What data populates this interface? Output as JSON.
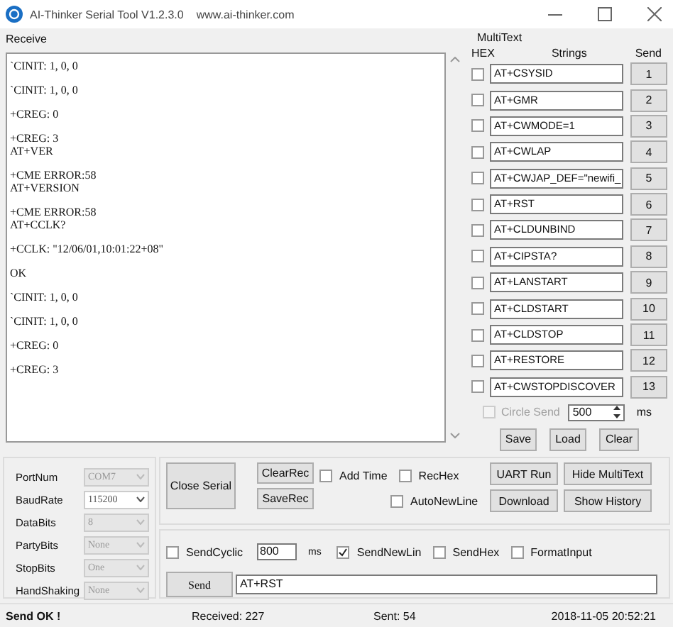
{
  "window": {
    "title": "AI-Thinker Serial Tool V1.2.3.0",
    "url": "www.ai-thinker.com"
  },
  "receive": {
    "label": "Receive",
    "blocks": [
      [
        "`CINIT: 1, 0, 0"
      ],
      [
        "`CINIT: 1, 0, 0"
      ],
      [
        "+CREG: 0"
      ],
      [
        "+CREG: 3",
        "AT+VER"
      ],
      [
        "+CME ERROR:58",
        "AT+VERSION"
      ],
      [
        "+CME ERROR:58",
        "AT+CCLK?"
      ],
      [
        "+CCLK: \"12/06/01,10:01:22+08\""
      ],
      [
        "OK"
      ],
      [
        "`CINIT: 1, 0, 0"
      ],
      [
        "`CINIT: 1, 0, 0"
      ],
      [
        "+CREG: 0"
      ],
      [
        "+CREG: 3"
      ]
    ]
  },
  "multitext": {
    "label": "MultiText",
    "headers": [
      "HEX",
      "Strings",
      "Send"
    ],
    "rows": [
      {
        "hex": false,
        "text": "AT+CSYSID",
        "send": "1"
      },
      {
        "hex": false,
        "text": "AT+GMR",
        "send": "2"
      },
      {
        "hex": false,
        "text": "AT+CWMODE=1",
        "send": "3"
      },
      {
        "hex": false,
        "text": "AT+CWLAP",
        "send": "4"
      },
      {
        "hex": false,
        "text": "AT+CWJAP_DEF=\"newifi_",
        "send": "5"
      },
      {
        "hex": false,
        "text": "AT+RST",
        "send": "6"
      },
      {
        "hex": false,
        "text": "AT+CLDUNBIND",
        "send": "7"
      },
      {
        "hex": false,
        "text": "AT+CIPSTA?",
        "send": "8"
      },
      {
        "hex": false,
        "text": "AT+LANSTART",
        "send": "9"
      },
      {
        "hex": false,
        "text": "AT+CLDSTART",
        "send": "10"
      },
      {
        "hex": false,
        "text": "AT+CLDSTOP",
        "send": "11"
      },
      {
        "hex": false,
        "text": "AT+RESTORE",
        "send": "12"
      },
      {
        "hex": false,
        "text": "AT+CWSTOPDISCOVER",
        "send": "13"
      }
    ],
    "circle_send": {
      "label": "Circle Send",
      "checked": false,
      "disabled": true,
      "interval": "500",
      "unit": "ms"
    },
    "buttons": [
      "Save",
      "Load",
      "Clear"
    ]
  },
  "serial": {
    "settings": [
      {
        "label": "PortNum",
        "value": "COM7",
        "disabled": true
      },
      {
        "label": "BaudRate",
        "value": "115200",
        "disabled": false
      },
      {
        "label": "DataBits",
        "value": "8",
        "disabled": true
      },
      {
        "label": "PartyBits",
        "value": "None",
        "disabled": true
      },
      {
        "label": "StopBits",
        "value": "One",
        "disabled": true
      },
      {
        "label": "HandShaking",
        "value": "None",
        "disabled": true
      }
    ]
  },
  "controls": {
    "close_button": "Close Serial",
    "clear_button": "ClearRec",
    "save_button": "SaveRec",
    "add_time": {
      "label": "Add Time",
      "checked": false
    },
    "rec_hex": {
      "label": "RecHex",
      "checked": false
    },
    "auto_newline": {
      "label": "AutoNewLine",
      "checked": false
    },
    "uart_button": "UART Run",
    "download_button": "Download",
    "hide_button": "Hide MultiText",
    "history_button": "Show History"
  },
  "send": {
    "cyclic": {
      "label": "SendCyclic",
      "checked": false
    },
    "interval": "800",
    "unit": "ms",
    "options": [
      {
        "label": "SendNewLin",
        "checked": true
      },
      {
        "label": "SendHex",
        "checked": false
      },
      {
        "label": "FormatInput",
        "checked": false
      }
    ],
    "button": "Send",
    "value": "AT+RST"
  },
  "status": {
    "message": "Send OK !",
    "received": "Received: 227",
    "sent": "Sent: 54",
    "time": "2018-11-05 20:52:21"
  }
}
